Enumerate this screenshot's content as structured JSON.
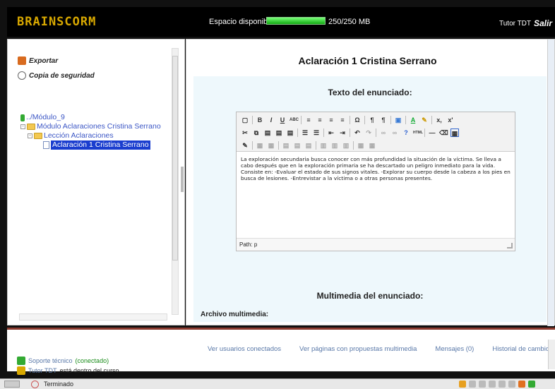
{
  "header": {
    "logo": "BRAINSCORM",
    "space_label": "Espacio disponible",
    "space_fraction": 1.0,
    "space_value": "250/250 MB",
    "user": "Tutor TDT",
    "logout": "Salir"
  },
  "left": {
    "actions": [
      "Exportar",
      "Copia de seguridad"
    ],
    "tree": {
      "root": "../Módulo_9",
      "module": "Módulo Aclaraciones Cristina Serrano",
      "lesson": "Lección Aclaraciones",
      "page": "Aclaración 1 Cristina Serrano"
    }
  },
  "main": {
    "title": "Aclaración 1 Cristina Serrano",
    "section_title": "Texto del enunciado:",
    "editor_text": "La exploración secundaria busca conocer con más profundidad la situación de la víctima. Se lleva a cabo después que en la exploración primaria se ha descartado un peligro inmediato para la vida. Consiste en: -Evaluar el estado de sus signos vitales. -Explorar su cuerpo desde la cabeza a los pies en busca de lesiones. -Entrevistar a la víctima o a otras personas presentes.",
    "path": "Path: p",
    "section2_title": "Multimedia del enunciado:",
    "field_label": "Archivo multimedia:"
  },
  "bottom": {
    "links": [
      "Ver usuarios conectados",
      "Ver páginas con propuestas multimedia",
      "Mensajes (0)",
      "Historial de cambios"
    ],
    "support": "Soporte técnico",
    "support_status": "(conectado)",
    "tutor_name": "Tutor TDT",
    "tutor_status": "está dentro del curso"
  },
  "status": {
    "text": "Terminado"
  }
}
